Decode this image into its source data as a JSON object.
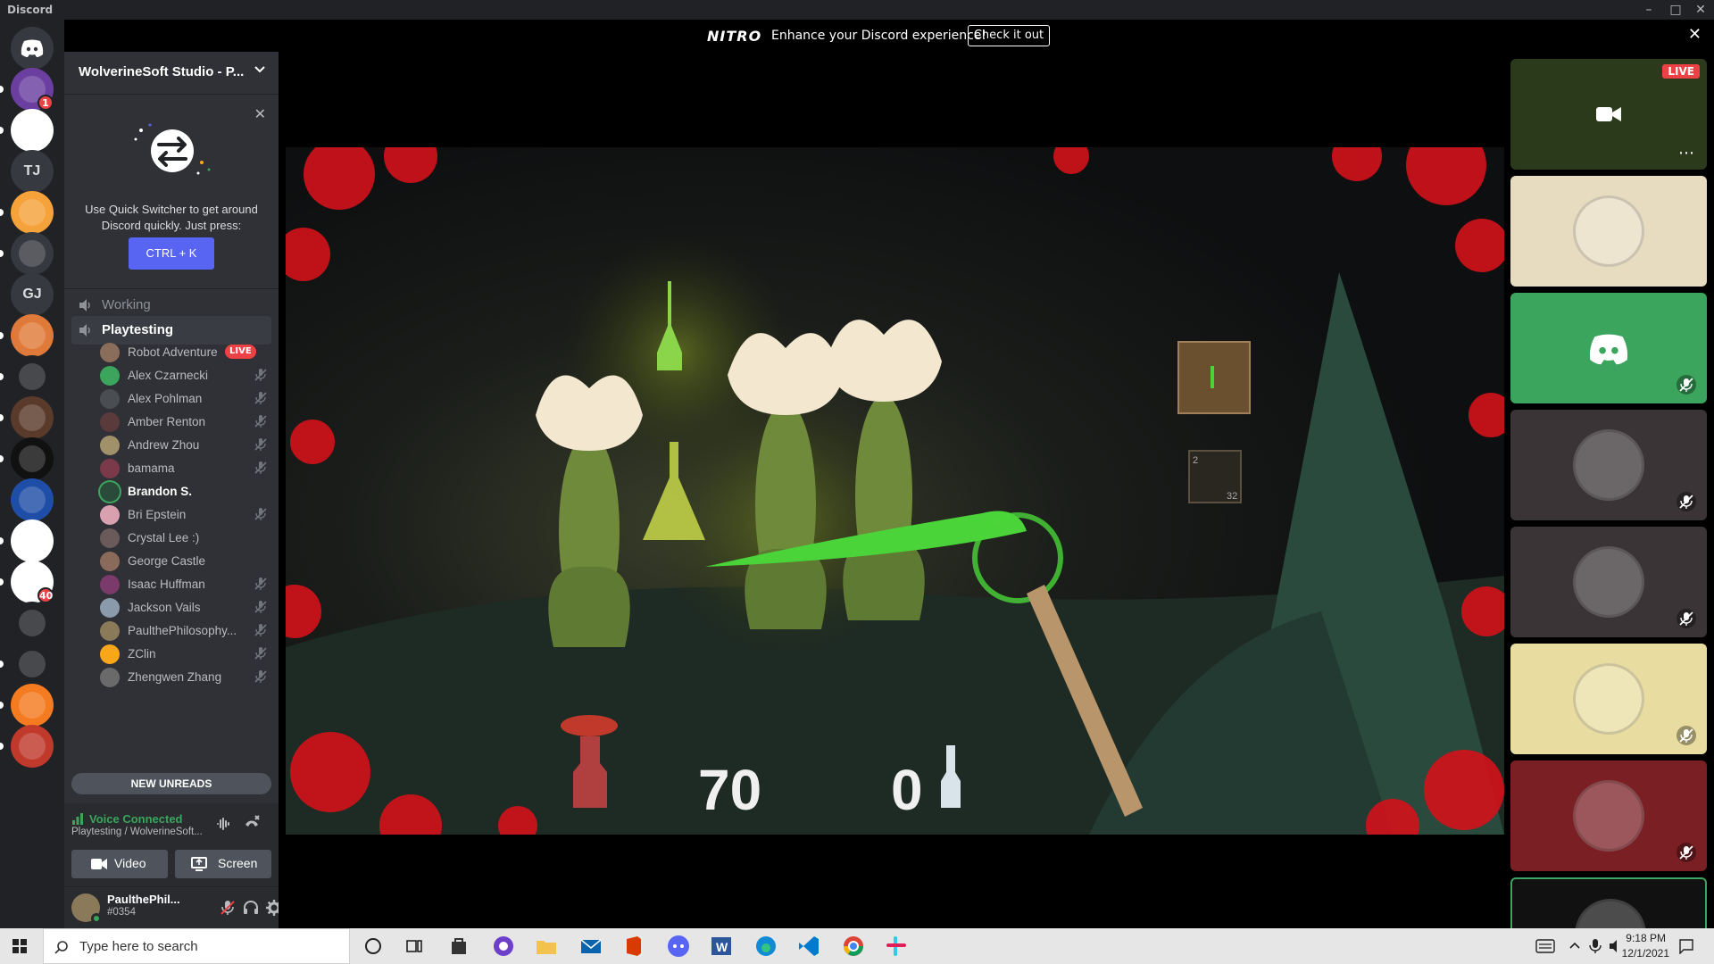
{
  "window": {
    "title": "Discord"
  },
  "nitro": {
    "logo": "NITRO",
    "message": "Enhance your Discord experience!",
    "cta": "Check it out"
  },
  "servers": [
    {
      "name": "home",
      "color": "#36393f",
      "initials": ""
    },
    {
      "name": "anime-server",
      "color": "#6b3fa0",
      "initials": "",
      "badge": "1"
    },
    {
      "name": "pink-f-server",
      "color": "#ffffff",
      "initials": ""
    },
    {
      "name": "TJ",
      "color": "#36393f",
      "initials": "TJ"
    },
    {
      "name": "cat-robot-server",
      "color": "#f6a23a",
      "initials": ""
    },
    {
      "name": "controller-server",
      "color": "#36393f",
      "initials": ""
    },
    {
      "name": "GJ",
      "color": "#36393f",
      "initials": "GJ"
    },
    {
      "name": "orange-server",
      "color": "#e07a3a",
      "initials": ""
    },
    {
      "name": "m-server",
      "color": "#202225",
      "initials": ""
    },
    {
      "name": "bloom-server",
      "color": "#5a3a2a",
      "initials": ""
    },
    {
      "name": "shapes-server",
      "color": "#111111",
      "initials": ""
    },
    {
      "name": "animation-club",
      "color": "#1f4ea8",
      "initials": ""
    },
    {
      "name": "studio-server",
      "color": "#ffffff",
      "initials": ""
    },
    {
      "name": "studio-server-2",
      "color": "#ffffff",
      "initials": "",
      "badge": "40"
    },
    {
      "name": "vtag-games",
      "color": "#202225",
      "initials": ""
    },
    {
      "name": "yellow-figure-server",
      "color": "#202225",
      "initials": ""
    },
    {
      "name": "fox-server",
      "color": "#f47b20",
      "initials": ""
    },
    {
      "name": "red-server",
      "color": "#c0392b",
      "initials": ""
    }
  ],
  "server_header": {
    "name": "WolverineSoft Studio - P..."
  },
  "quick_switcher": {
    "text": "Use Quick Switcher to get around Discord quickly. Just press:",
    "shortcut": "CTRL + K"
  },
  "channels": [
    {
      "label": "Working",
      "selected": false
    },
    {
      "label": "Playtesting",
      "selected": true
    }
  ],
  "members": [
    {
      "name": "Robot Adventure",
      "live": true,
      "live_label": "LIVE",
      "avatar_color": "#8a6d5a",
      "muted": false
    },
    {
      "name": "Alex Czarnecki",
      "live": false,
      "avatar_color": "#3ba55d",
      "muted": true
    },
    {
      "name": "Alex Pohlman",
      "live": false,
      "avatar_color": "#4a4d52",
      "muted": true
    },
    {
      "name": "Amber Renton",
      "live": false,
      "avatar_color": "#5a3a3a",
      "muted": true
    },
    {
      "name": "Andrew Zhou",
      "live": false,
      "avatar_color": "#a0916a",
      "muted": true
    },
    {
      "name": "bamama",
      "live": false,
      "avatar_color": "#7a3a4a",
      "muted": true
    },
    {
      "name": "Brandon S.",
      "live": false,
      "avatar_color": "#2a4a3a",
      "muted": false,
      "speaking": true
    },
    {
      "name": "Bri Epstein",
      "live": false,
      "avatar_color": "#d9a0b0",
      "muted": true
    },
    {
      "name": "Crystal Lee :)",
      "live": false,
      "avatar_color": "#6a5a5a",
      "muted": false
    },
    {
      "name": "George Castle",
      "live": false,
      "avatar_color": "#8a6a5a",
      "muted": false
    },
    {
      "name": "Isaac Huffman",
      "live": false,
      "avatar_color": "#7a3a6a",
      "muted": true
    },
    {
      "name": "Jackson Vails",
      "live": false,
      "avatar_color": "#8a9aaa",
      "muted": true
    },
    {
      "name": "PaulthePhilosophy...",
      "live": false,
      "avatar_color": "#8a7a5a",
      "muted": true
    },
    {
      "name": "ZClin",
      "live": false,
      "avatar_color": "#faa61a",
      "muted": true
    },
    {
      "name": "Zhengwen Zhang",
      "live": false,
      "avatar_color": "#6a6a6a",
      "muted": true
    }
  ],
  "new_unreads": "NEW UNREADS",
  "voice": {
    "status": "Voice Connected",
    "channel": "Playtesting / WolverineSoft...",
    "video_label": "Video",
    "screen_label": "Screen"
  },
  "user": {
    "name": "PaulthePhil...",
    "tag": "#0354"
  },
  "stream": {
    "hud_health": "70",
    "hud_mana": "0",
    "minimap_a": "2",
    "minimap_b": "32"
  },
  "tiles": [
    {
      "kind": "stream",
      "live_label": "LIVE",
      "bg": "#2a3a1a"
    },
    {
      "kind": "avatar",
      "bg": "#e8dcc0",
      "muted": false
    },
    {
      "kind": "discord",
      "bg": "#3ba55d",
      "muted": true
    },
    {
      "kind": "avatar",
      "bg": "#3a3436",
      "muted": true
    },
    {
      "kind": "avatar",
      "bg": "#3a3436",
      "muted": true
    },
    {
      "kind": "avatar",
      "bg": "#e8dca0",
      "muted": true
    },
    {
      "kind": "avatar",
      "bg": "#7a1f24",
      "muted": true
    },
    {
      "kind": "avatar",
      "bg": "#111111",
      "muted": false
    }
  ],
  "taskbar": {
    "search_placeholder": "Type here to search",
    "time": "9:18 PM",
    "date": "12/1/2021"
  }
}
